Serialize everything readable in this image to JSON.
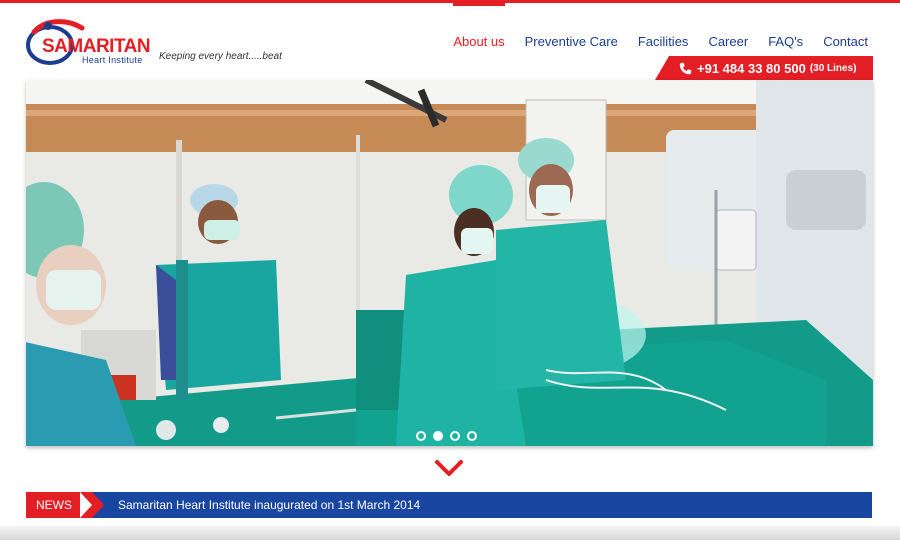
{
  "brand": {
    "name": "SAMARITAN",
    "subtitle": "Heart Institute",
    "tagline": "Keeping every heart.....beat",
    "red": "#e31e24",
    "blue": "#1d3d8f"
  },
  "nav": {
    "items": [
      {
        "label": "About us",
        "active": true
      },
      {
        "label": "Preventive Care",
        "active": false
      },
      {
        "label": "Facilities",
        "active": false
      },
      {
        "label": "Career",
        "active": false
      },
      {
        "label": "FAQ's",
        "active": false
      },
      {
        "label": "Contact",
        "active": false
      }
    ]
  },
  "contact": {
    "phone": "+91 484 33 80 500",
    "lines": "(30 Lines)",
    "icon": "phone-icon"
  },
  "slider": {
    "image": "surgeons-in-operating-room",
    "slide_count": 4,
    "active_slide": 2
  },
  "news": {
    "label": "NEWS",
    "headline": "Samaritan Heart Institute inaugurated on 1st March 2014",
    "bar_color": "#1846a0"
  }
}
